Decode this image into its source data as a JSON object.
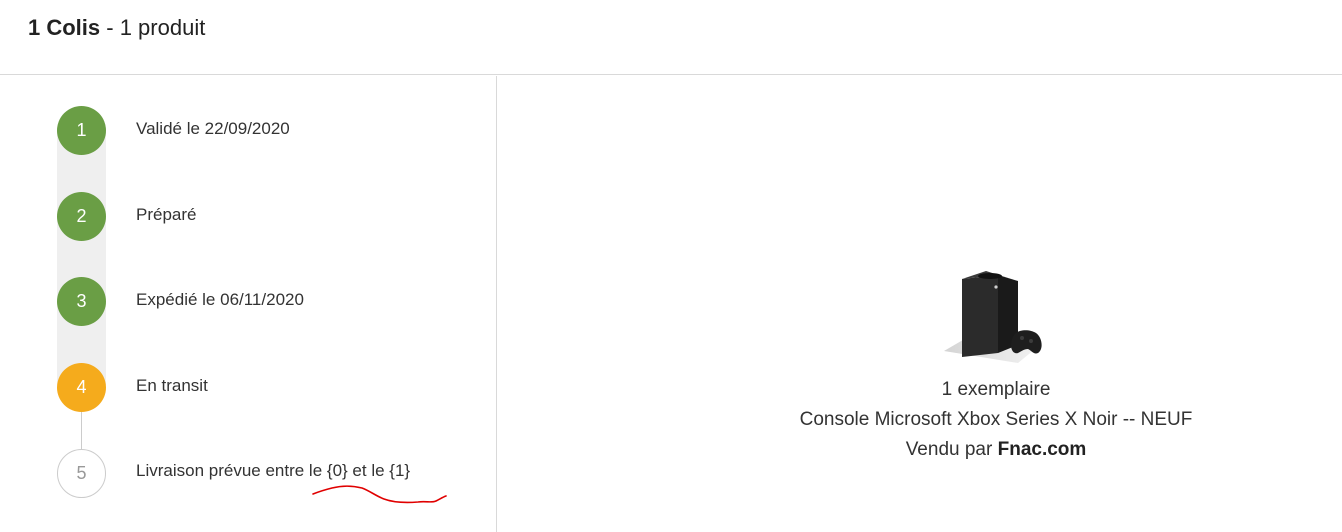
{
  "header": {
    "colis_count": "1 Colis",
    "separator": " - ",
    "product_count": "1 produit"
  },
  "steps": [
    {
      "number": "1",
      "label": "Validé le 22/09/2020",
      "status": "done"
    },
    {
      "number": "2",
      "label": "Préparé",
      "status": "done"
    },
    {
      "number": "3",
      "label": "Expédié le 06/11/2020",
      "status": "done"
    },
    {
      "number": "4",
      "label": "En transit",
      "status": "current"
    },
    {
      "number": "5",
      "label": "Livraison prévue entre le {0} et le {1}",
      "status": "future"
    }
  ],
  "product": {
    "image_icon": "xbox-series-x-console-image",
    "quantity": "1 exemplaire",
    "name": "Console Microsoft Xbox Series X Noir -- NEUF",
    "seller_prefix": "Vendu par ",
    "seller_name": "Fnac.com"
  },
  "colors": {
    "done": "#6a9e45",
    "current": "#f5ab1c",
    "future_border": "#cccccc",
    "annotation": "#e00000"
  }
}
